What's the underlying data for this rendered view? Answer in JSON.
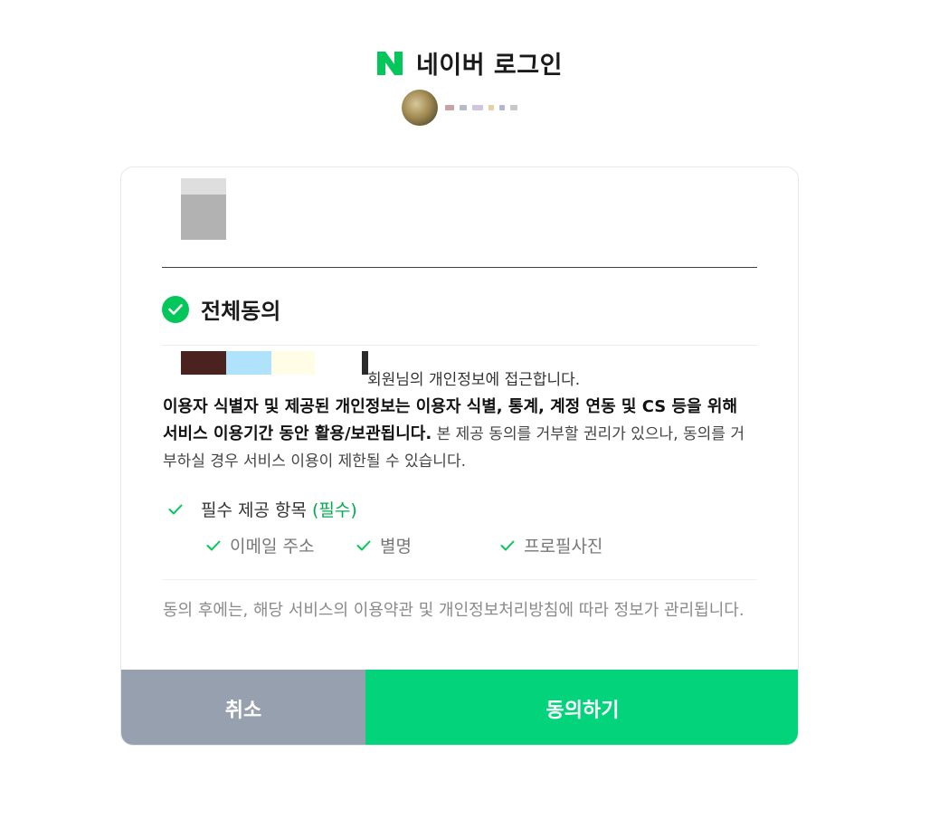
{
  "header": {
    "title": "네이버 로그인",
    "logo_color": "#03c75a"
  },
  "consent": {
    "agree_all_label": "전체동의",
    "intro_text": "회원님의 개인정보에 접근합니다.",
    "bold_text": "이용자 식별자 및 제공된 개인정보는 이용자 식별, 통계, 계정 연동 및 CS 등을 위해 서비스 이용기간 동안 활용/보관됩니다.",
    "rest_text": " 본 제공 동의를 거부할 권리가 있으나, 동의를 거부하실 경우 서비스 이용이 제한될 수 있습니다.",
    "required_label": "필수 제공 항목",
    "required_tag": "(필수)",
    "items": [
      "이메일 주소",
      "별명",
      "프로필사진"
    ],
    "footer_note": "동의 후에는, 해당 서비스의 이용약관 및 개인정보처리방침에 따라 정보가 관리됩니다."
  },
  "buttons": {
    "cancel_label": "취소",
    "agree_label": "동의하기"
  },
  "colors": {
    "accent": "#03c75a",
    "agree_button": "#03d47c",
    "cancel_button": "#97a0af"
  }
}
